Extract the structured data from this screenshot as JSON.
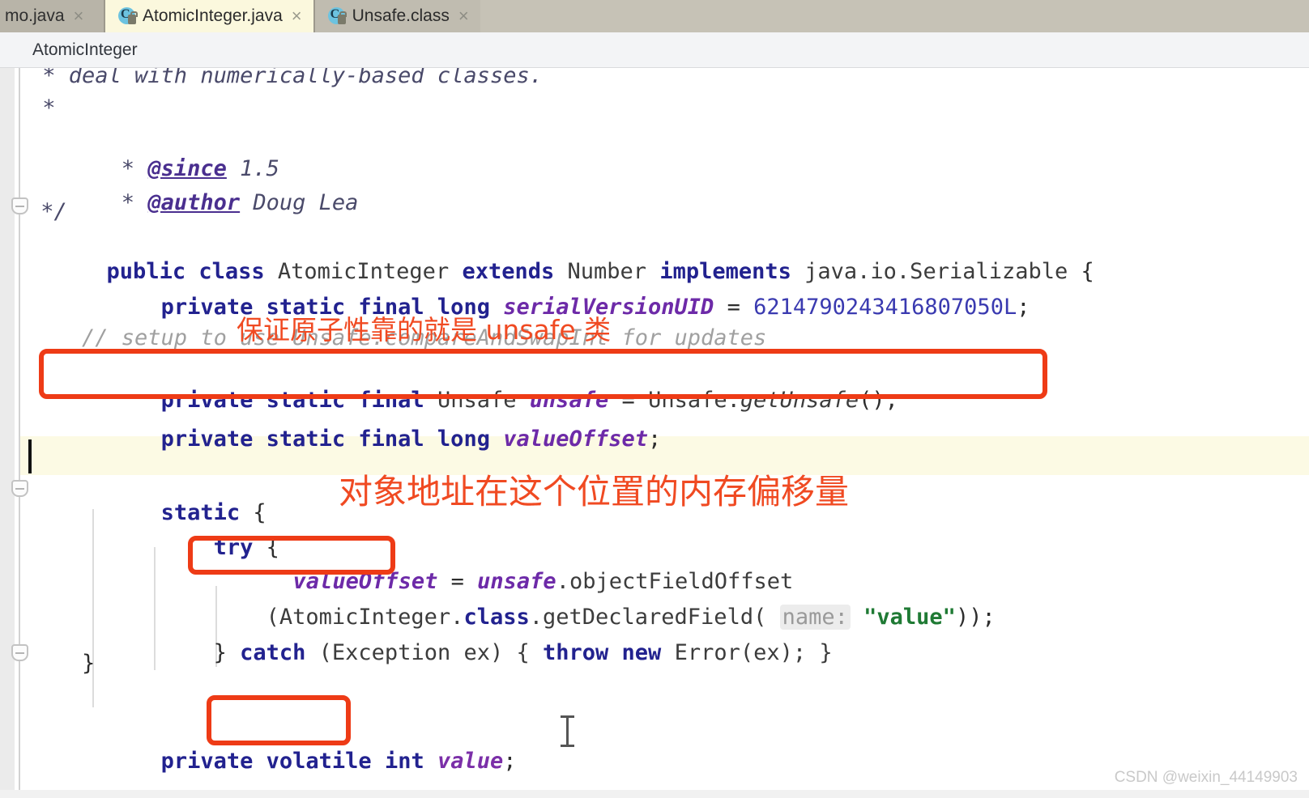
{
  "window": {
    "breadcrumb": "AtomicInteger"
  },
  "tabs": [
    {
      "label": "mo.java",
      "icon": "java-file-icon",
      "close": "×",
      "state": "inactive"
    },
    {
      "label": "AtomicInteger.java",
      "icon": "java-file-icon",
      "close": "×",
      "state": "selected"
    },
    {
      "label": "Unsafe.class",
      "icon": "class-file-icon",
      "close": "×",
      "state": "inactive"
    }
  ],
  "code": {
    "l01": " * deal with numerically-based classes.",
    "l02": " *",
    "l03_star": " * ",
    "l03_tag": "@since",
    "l03_rest": " 1.5",
    "l04_star": " * ",
    "l04_tag": "@author",
    "l04_rest": " Doug Lea",
    "l05": " */",
    "l06_a": "public class ",
    "l06_b": "AtomicInteger",
    "l06_c": " extends ",
    "l06_d": "Number",
    "l06_e": " implements ",
    "l06_f": "java.io.Serializable",
    "l06_g": " {",
    "l07_kw": "    private static final long ",
    "l07_name": "serialVersionUID",
    "l07_eq": " = ",
    "l07_val": "6214790243416807050",
    "l07_suffix": "L",
    "l07_end": ";",
    "l08_comment": "    // setup to use Unsafe.compareAndSwapInt for updates",
    "l09_kw": "    private static final ",
    "l09_type": "Unsafe ",
    "l09_name": "unsafe",
    "l09_eq": " = ",
    "l09_call": "Unsafe.",
    "l09_mth": "getUnsafe",
    "l09_end": "();",
    "l10_kw": "    private static final long ",
    "l10_name": "valueOffset",
    "l10_end": ";",
    "l11": "",
    "l12_kw": "    static ",
    "l12_brace": "{",
    "l13_kw": "        try ",
    "l13_brace": "{",
    "l14_name": "valueOffset",
    "l14_eq": " = ",
    "l14_obj": "unsafe",
    "l14_mth": ".objectFieldOffset",
    "l15_a": "            (AtomicInteger.",
    "l15_class": "class",
    "l15_b": ".getDeclaredField( ",
    "l15_hint": "name:",
    "l15_c": " ",
    "l15_str": "\"value\"",
    "l15_d": "));",
    "l16_a": "        } ",
    "l16_catch": "catch ",
    "l16_b": "(Exception ex) { ",
    "l16_throw": "throw new ",
    "l16_c": "Error(ex); }",
    "l17": "    }",
    "l18": "",
    "l19_kw": "    private ",
    "l19_vol": "volatile ",
    "l19_int": "int ",
    "l19_name": "value",
    "l19_end": ";"
  },
  "annotations": {
    "note1": "保证原子性靠的就是 unsafe 类",
    "note2": "对象地址在这个位置的内存偏移量",
    "color": "#f04a22",
    "box_color": "#ee3b16",
    "boxed_items": [
      "unsafe-declaration-line",
      "valueOffset-identifier",
      "volatile-keyword"
    ]
  },
  "watermark": "CSDN @weixin_44149903"
}
